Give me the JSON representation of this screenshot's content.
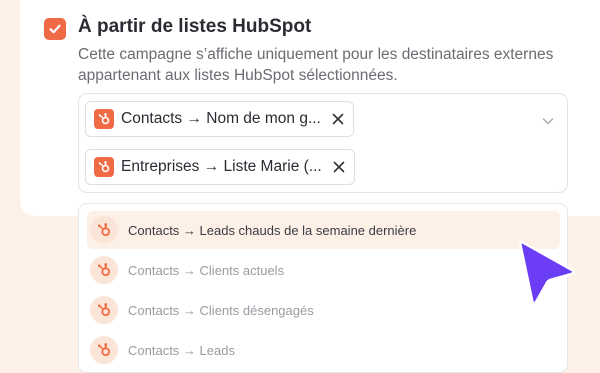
{
  "section": {
    "checked": true,
    "title": "À partir de listes HubSpot",
    "description": "Cette campagne s’affiche uniquement pour les destinataires externes appartenant aux listes HubSpot sélectionnées."
  },
  "selected_chips": [
    {
      "label": "Contacts → Nom de mon g...",
      "icon": "hubspot-icon",
      "remove_icon": "close-icon"
    },
    {
      "label": "Entreprises → Liste Marie (...",
      "icon": "hubspot-icon",
      "remove_icon": "close-icon"
    }
  ],
  "dropdown": {
    "options": [
      {
        "label": "Contacts → Leads chauds de la semaine dernière",
        "highlighted": true
      },
      {
        "label": "Contacts → Clients actuels",
        "highlighted": false
      },
      {
        "label": "Contacts → Clients désengagés",
        "highlighted": false
      },
      {
        "label": "Contacts → Leads",
        "highlighted": false
      }
    ]
  },
  "colors": {
    "accent": "#f06a45",
    "background": "#fdf1e8",
    "cursor": "#6b3df5"
  },
  "icons": {
    "checkbox": "checkmark-icon",
    "expand": "chevron-down-icon",
    "pointer": "pointer-cursor-icon"
  }
}
